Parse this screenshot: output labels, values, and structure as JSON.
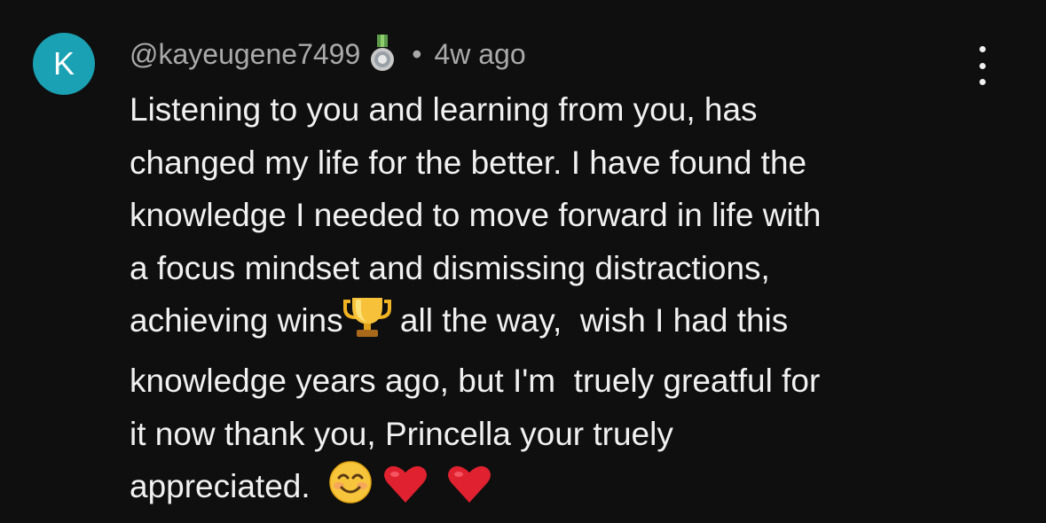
{
  "avatar": {
    "initial": "K",
    "color": "#1aa1b3"
  },
  "header": {
    "username": "@kayeugene7499",
    "badge_icon": "member-badge-medal-icon",
    "separator": "•",
    "timestamp": "4w ago"
  },
  "menu": {
    "icon": "more-vertical-icon"
  },
  "comment": {
    "lines": [
      "Listening to you and learning from you, has",
      "changed my life for the better. I have found the",
      "knowledge I needed to move forward in life with",
      "a focus mindset and dismissing distractions,",
      "achieving wins",
      "all the way,  wish I had this",
      "knowledge years ago, but I'm  truely greatful for",
      "it now thank you, Princella your truely",
      "appreciated."
    ],
    "emojis": [
      "trophy-emoji",
      "smiling-face-emoji",
      "red-heart-emoji",
      "red-heart-emoji"
    ]
  },
  "colors": {
    "background": "#0f0f0f",
    "text": "#f1f1f1",
    "secondary_text": "#aaaaaa"
  }
}
